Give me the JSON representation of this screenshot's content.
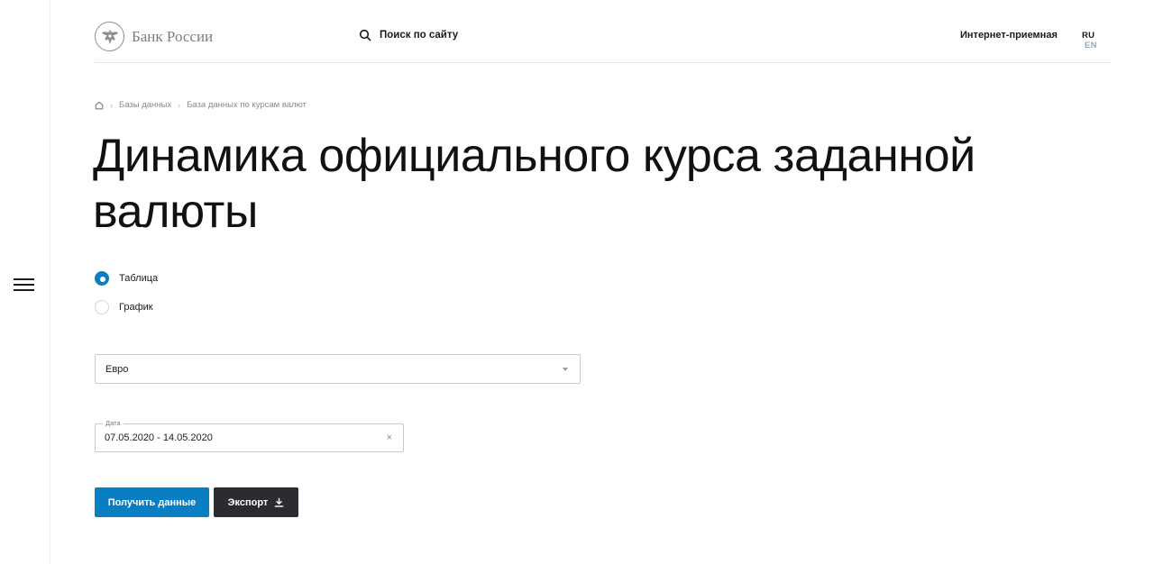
{
  "header": {
    "logo_text": "Банк России",
    "search_label": "Поиск по сайту",
    "reception_link": "Интернет-приемная",
    "lang_ru": "RU",
    "lang_en": "EN"
  },
  "breadcrumb": {
    "items": [
      "Базы данных",
      "База данных по курсам валют"
    ]
  },
  "page": {
    "title": "Динамика официального курса заданной валюты"
  },
  "view_mode": {
    "options": [
      "Таблица",
      "График"
    ],
    "selected": "Таблица"
  },
  "currency_select": {
    "value": "Евро"
  },
  "date_field": {
    "label": "Дата",
    "value": "07.05.2020 - 14.05.2020",
    "clear_symbol": "×"
  },
  "actions": {
    "get_data_label": "Получить данные",
    "export_label": "Экспорт"
  },
  "colors": {
    "accent": "#0a7ec2",
    "dark_button": "#2a2c31"
  },
  "icons": {
    "menu": "hamburger-icon",
    "search": "search-icon",
    "home": "home-icon",
    "download": "download-icon",
    "logo": "eagle-emblem-icon"
  }
}
